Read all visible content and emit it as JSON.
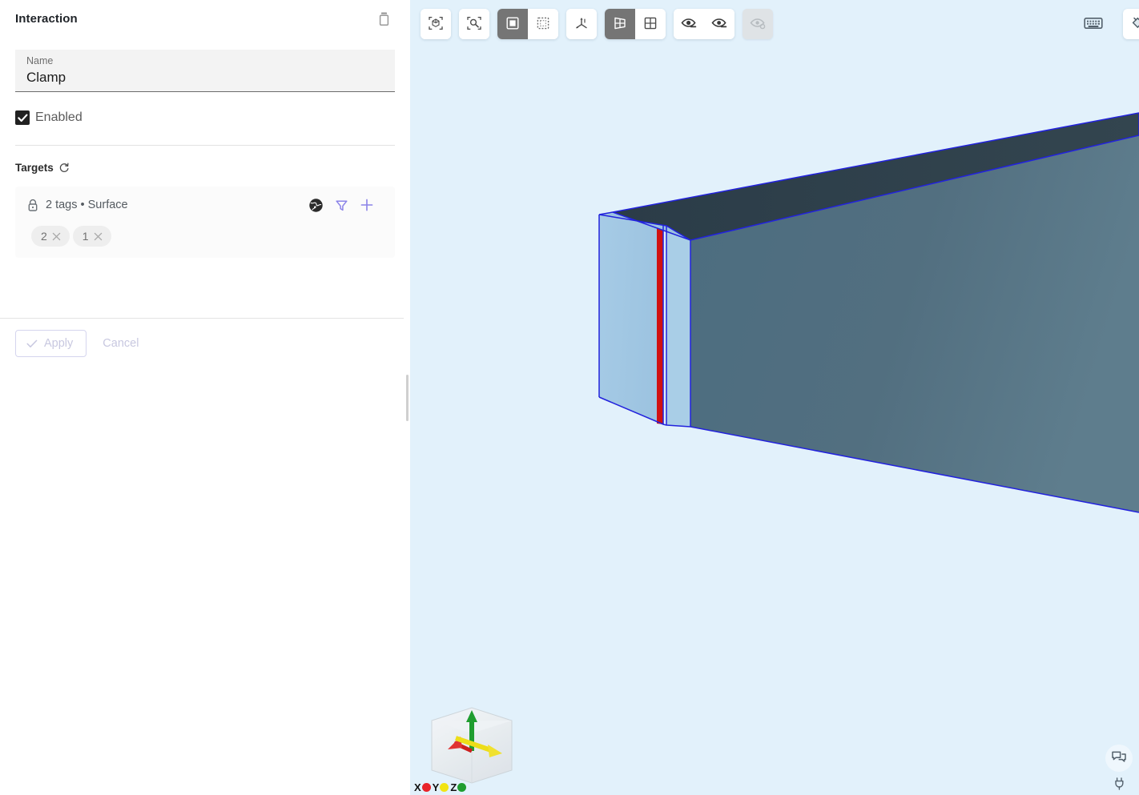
{
  "panel": {
    "title": "Interaction",
    "delete_icon": "trash-icon",
    "name_field": {
      "label": "Name",
      "value": "Clamp",
      "placeholder": "Name"
    },
    "enabled_checkbox": {
      "label": "Enabled",
      "checked": true
    },
    "targets": {
      "title": "Targets",
      "refresh_icon": "refresh-icon",
      "lock_icon": "lock-icon",
      "summary": "2 tags • Surface",
      "actions": [
        "globe-icon",
        "filter-icon",
        "plus-icon"
      ],
      "chips": [
        {
          "label": "2",
          "remove_icon": "close-icon"
        },
        {
          "label": "1",
          "remove_icon": "close-icon"
        }
      ]
    },
    "footer": {
      "apply_label": "Apply",
      "apply_icon": "check-icon",
      "cancel_label": "Cancel",
      "apply_disabled": true,
      "cancel_disabled": true
    }
  },
  "viewport": {
    "background": "#e2f1fb",
    "toolbar": [
      {
        "name": "fit-to-view-button",
        "icon": "cube-focus-icon",
        "active": false,
        "disabled": false
      },
      {
        "name": "zoom-to-selection-button",
        "icon": "magnify-focus-icon",
        "active": false,
        "disabled": false
      },
      {
        "name": "select-box-button",
        "icon": "filled-square-icon",
        "active": true,
        "disabled": false
      },
      {
        "name": "select-marquee-button",
        "icon": "dashed-square-icon",
        "active": false,
        "disabled": false
      },
      {
        "name": "axes-button",
        "icon": "axes-icon",
        "active": false,
        "disabled": false
      },
      {
        "name": "perspective-view-button",
        "icon": "perspective-grid-icon",
        "active": true,
        "disabled": false
      },
      {
        "name": "ortho-view-button",
        "icon": "grid-square-icon",
        "active": false,
        "disabled": false
      },
      {
        "name": "hide-selected-button",
        "icon": "eye-minus-icon",
        "active": false,
        "disabled": false
      },
      {
        "name": "show-selected-button",
        "icon": "eye-plus-icon",
        "active": false,
        "disabled": false
      },
      {
        "name": "show-all-button",
        "icon": "eye-off-icon",
        "active": false,
        "disabled": true
      }
    ],
    "keyboard_shortcuts_icon": "keyboard-icon",
    "fill_color_icon": "paint-bucket-icon",
    "comments_icon": "comment-icon",
    "connection_icon": "plug-icon",
    "axis_gizmo": {
      "axes": [
        {
          "label": "X",
          "color": "#e8232a"
        },
        {
          "label": "Y",
          "color": "#f2e413"
        },
        {
          "label": "Z",
          "color": "#1f9d2f"
        }
      ]
    },
    "model": {
      "name": "beam",
      "face_selected_color": "#9fc7e3",
      "body_color": "#4e6e80",
      "top_face_color": "#2c3e4a",
      "edge_color": "#2222dd",
      "highlight_edge_color": "#d11111"
    }
  }
}
